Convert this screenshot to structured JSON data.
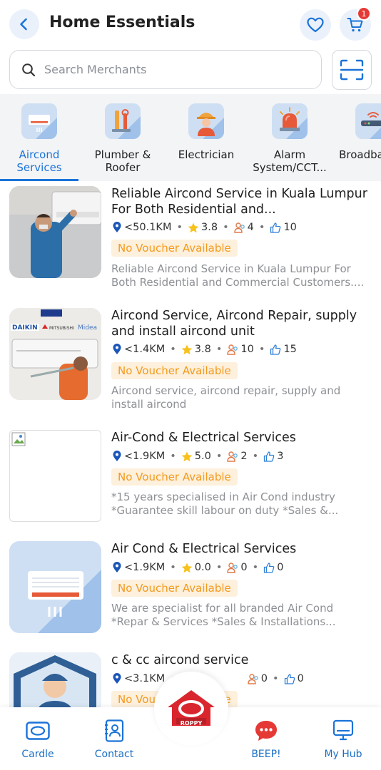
{
  "header": {
    "title": "Home Essentials",
    "cart_count": "1"
  },
  "search": {
    "placeholder": "Search Merchants"
  },
  "categories": [
    {
      "label": "Aircond Services",
      "active": true,
      "icon": "aircond-icon"
    },
    {
      "label": "Plumber & Roofer",
      "active": false,
      "icon": "plumber-icon"
    },
    {
      "label": "Electrician",
      "active": false,
      "icon": "electrician-icon"
    },
    {
      "label": "Alarm System/CCT...",
      "active": false,
      "icon": "alarm-icon"
    },
    {
      "label": "Broadba Telc",
      "active": false,
      "icon": "broadband-icon"
    }
  ],
  "listings": [
    {
      "title": "Reliable Aircond Service in Kuala Lumpur For Both Residential and...",
      "distance": "<50.1KM",
      "rating": "3.8",
      "customers": "4",
      "likes": "10",
      "voucher": "No Voucher Available",
      "description": "Reliable Aircond Service in Kuala Lumpur For Both Residential and Commercial Customers...."
    },
    {
      "title": "Aircond Service, Aircond Repair, supply and install aircond unit",
      "distance": "<1.4KM",
      "rating": "3.8",
      "customers": "10",
      "likes": "15",
      "voucher": "No Voucher Available",
      "description": "Aircond service, aircond repair, supply and install aircond"
    },
    {
      "title": "Air-Cond & Electrical Services",
      "distance": "<1.9KM",
      "rating": "5.0",
      "customers": "2",
      "likes": "3",
      "voucher": "No Voucher Available",
      "description": "*15 years specialised in Air Cond industry *Guarantee skill labour on duty *Sales &..."
    },
    {
      "title": "Air Cond & Electrical Services",
      "distance": "<1.9KM",
      "rating": "0.0",
      "customers": "0",
      "likes": "0",
      "voucher": "No Voucher Available",
      "description": "We are specialist for all branded Air Cond *Repar & Services *Sales & Installations..."
    },
    {
      "title": "c & cc aircond service",
      "distance": "<3.1KM",
      "rating": "",
      "customers": "0",
      "likes": "0",
      "voucher": "No Voucher Available",
      "description": ""
    }
  ],
  "bottom_nav": {
    "items": [
      {
        "label": "Cardle",
        "icon": "card-icon"
      },
      {
        "label": "Contact",
        "icon": "contact-book-icon"
      },
      {
        "label": "BEEP!",
        "icon": "chat-bubble-icon"
      },
      {
        "label": "My Hub",
        "icon": "monitor-icon"
      }
    ],
    "center_logo_text": "ROPPY"
  },
  "colors": {
    "accent": "#1a73d8",
    "voucher_bg": "#fdf0dc",
    "voucher_text": "#f39a1e",
    "badge": "#e53935",
    "beep": "#e53935"
  }
}
